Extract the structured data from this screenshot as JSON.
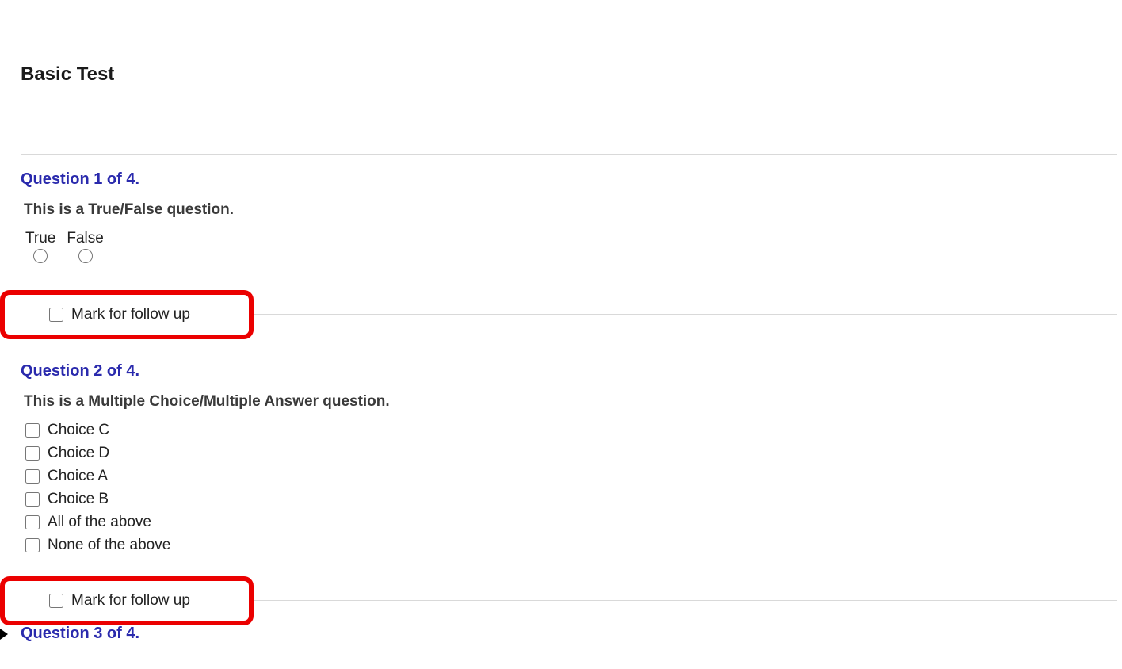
{
  "title": "Basic Test",
  "questions": [
    {
      "heading": "Question 1 of 4.",
      "prompt": "This is a True/False question.",
      "tf": {
        "true_label": "True",
        "false_label": "False"
      },
      "followup": "Mark for follow up"
    },
    {
      "heading": "Question 2 of 4.",
      "prompt": "This is a Multiple Choice/Multiple Answer question.",
      "choices": [
        "Choice C",
        "Choice D",
        "Choice A",
        "Choice B",
        "All of the above",
        "None of the above"
      ],
      "followup": "Mark for follow up"
    },
    {
      "heading": "Question 3 of 4."
    }
  ]
}
